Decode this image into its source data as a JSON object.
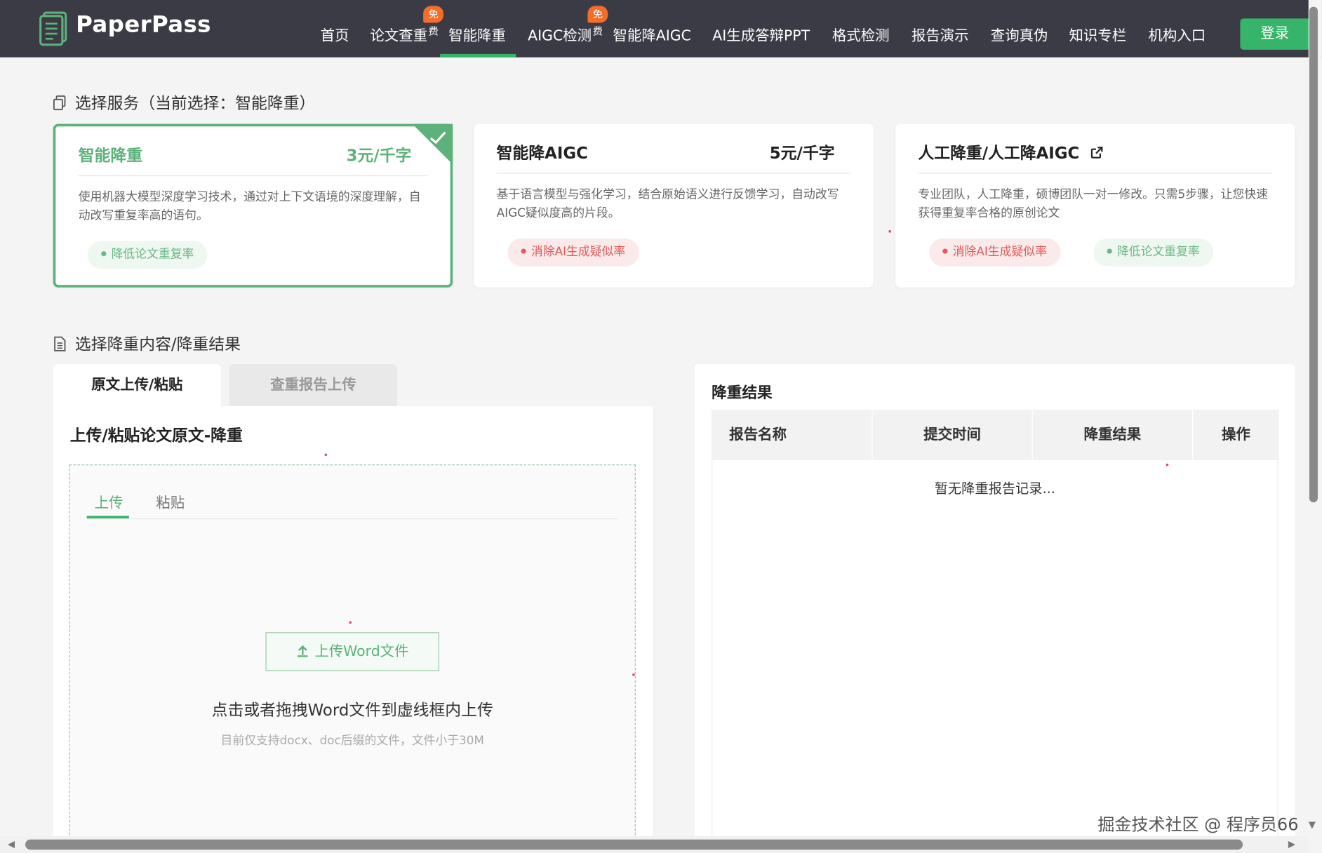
{
  "header": {
    "brand": "PaperPass",
    "nav": [
      {
        "label": "首页"
      },
      {
        "label": "论文查重",
        "badge": "免费"
      },
      {
        "label": "智能降重",
        "active": true
      },
      {
        "label": "AIGC检测",
        "badge": "免费"
      },
      {
        "label": "智能降AIGC"
      },
      {
        "label": "AI生成答辩PPT"
      },
      {
        "label": "格式检测"
      },
      {
        "label": "报告演示"
      },
      {
        "label": "查询真伪"
      },
      {
        "label": "知识专栏"
      },
      {
        "label": "机构入口"
      }
    ],
    "login": "登录"
  },
  "service_section": {
    "title": "选择服务（当前选择：智能降重）",
    "cards": [
      {
        "name": "智能降重",
        "price": "3元/千字",
        "selected": true,
        "desc": "使用机器大模型深度学习技术，通过对上下文语境的深度理解，自动改写重复率高的语句。",
        "tags": [
          {
            "label": "降低论文重复率",
            "color": "green"
          }
        ]
      },
      {
        "name": "智能降AIGC",
        "price": "5元/千字",
        "selected": false,
        "desc": "基于语言模型与强化学习，结合原始语义进行反馈学习，自动改写AIGC疑似度高的片段。",
        "tags": [
          {
            "label": "消除AI生成疑似率",
            "color": "red"
          }
        ]
      },
      {
        "name": "人工降重/人工降AIGC",
        "price": "",
        "selected": false,
        "external_icon": "external-link-icon",
        "desc": "专业团队，人工降重，硕博团队一对一修改。只需5步骤，让您快速获得重复率合格的原创论文",
        "tags": [
          {
            "label": "消除AI生成疑似率",
            "color": "red"
          },
          {
            "label": "降低论文重复率",
            "color": "green"
          }
        ]
      }
    ]
  },
  "content_section": {
    "title": "选择降重内容/降重结果",
    "tabs": [
      {
        "label": "原文上传/粘贴",
        "active": true
      },
      {
        "label": "查重报告上传",
        "active": false
      }
    ],
    "panel_title": "上传/粘贴论文原文-降重",
    "subtabs": [
      {
        "label": "上传",
        "active": true
      },
      {
        "label": "粘贴",
        "active": false
      }
    ],
    "upload_button": "上传Word文件",
    "drop_hint": "点击或者拖拽Word文件到虚线框内上传",
    "drop_sub": "目前仅支持docx、doc后缀的文件，文件小于30M"
  },
  "results": {
    "title": "降重结果",
    "columns": [
      "报告名称",
      "提交时间",
      "降重结果",
      "操作"
    ],
    "rows": [],
    "empty_text": "暂无降重报告记录..."
  },
  "watermark": "掘金技术社区 @ 程序员66",
  "colors": {
    "header_bg": "#3b3b45",
    "accent": "#35b46a",
    "selected_card": "#5cb27a",
    "badge": "#f46d2a",
    "tag_red": "#e25a5a"
  }
}
